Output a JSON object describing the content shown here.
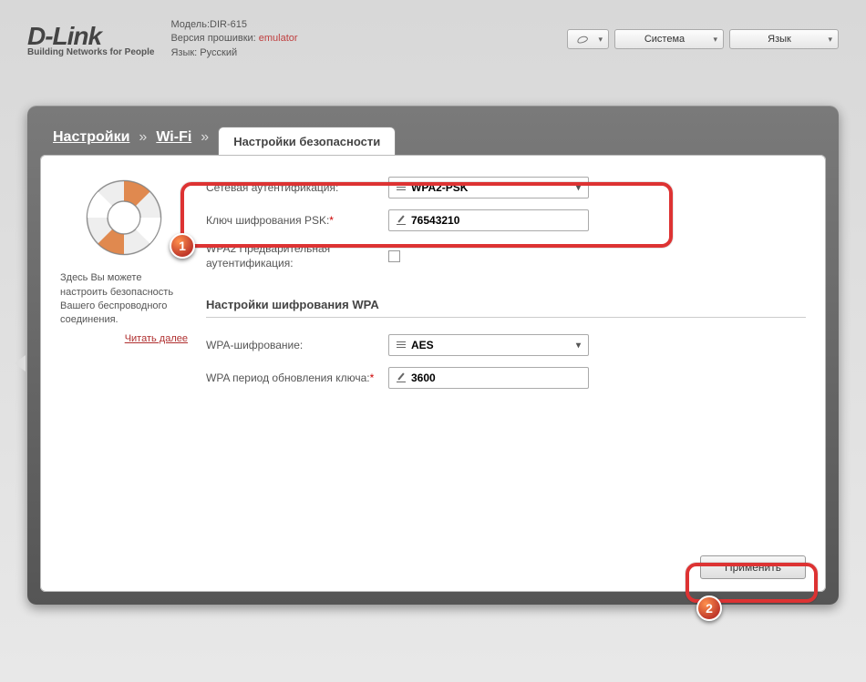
{
  "header": {
    "logo_brand": "D-Link",
    "logo_tagline": "Building Networks for People",
    "model_label": "Модель:",
    "model_value": "DIR-615",
    "firmware_label": "Версия прошивки:",
    "firmware_value": "emulator",
    "language_info_label": "Язык:",
    "language_info_value": "Русский",
    "menu_system": "Система",
    "menu_language": "Язык"
  },
  "breadcrumb": {
    "root": "Настройки",
    "section": "Wi-Fi",
    "active_tab": "Настройки безопасности"
  },
  "help": {
    "text": "Здесь Вы можете настроить безопасность Вашего беспроводного соединения.",
    "read_more": "Читать далее"
  },
  "form": {
    "auth_label": "Сетевая аутентификация:",
    "auth_value": "WPA2-PSK",
    "psk_label": "Ключ шифрования PSK:",
    "psk_value": "76543210",
    "preauth_label": "WPA2 Предварительная аутентификация:",
    "section_wpa": "Настройки шифрования WPA",
    "enc_label": "WPA-шифрование:",
    "enc_value": "AES",
    "rekey_label": "WPA период обновления ключа:",
    "rekey_value": "3600",
    "apply_button": "Применить"
  },
  "callouts": {
    "one": "1",
    "two": "2"
  }
}
